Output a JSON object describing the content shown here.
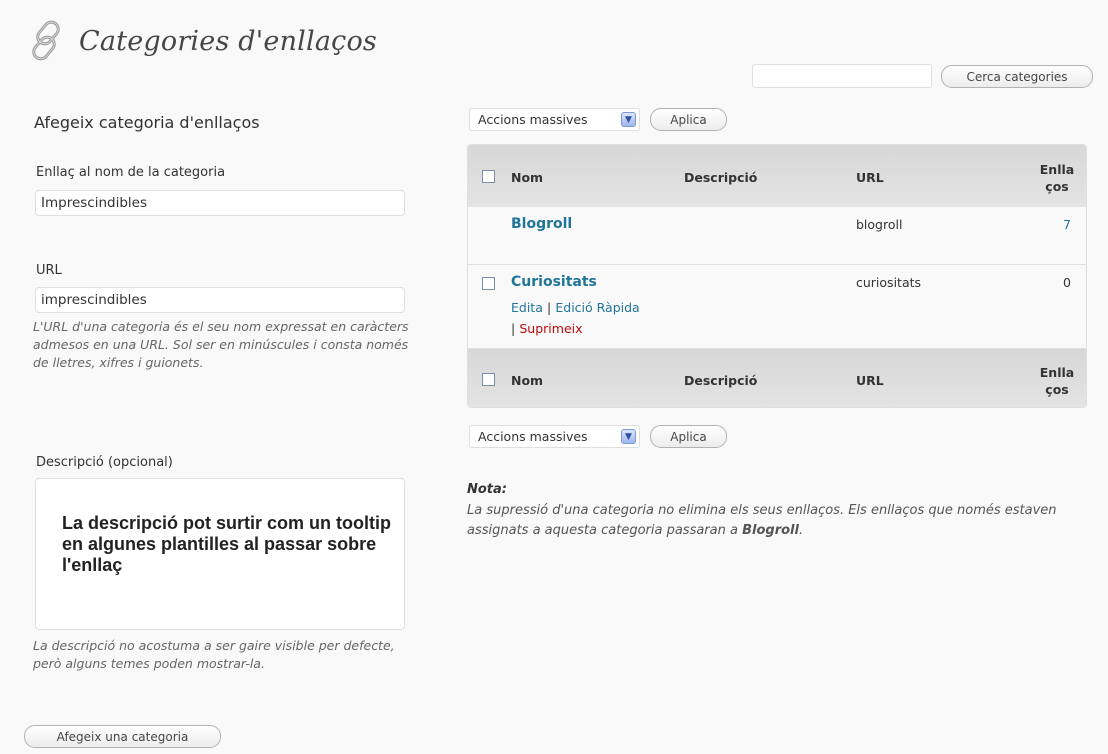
{
  "page": {
    "title": "Categories d'enllaços",
    "icon": "link-icon"
  },
  "search": {
    "button_label": "Cerca categories",
    "placeholder": ""
  },
  "form": {
    "heading": "Afegeix categoria d'enllaços",
    "name_label": "Enllaç al nom de la categoria",
    "name_value": "Imprescindibles",
    "url_label": "URL",
    "url_value": "imprescindibles",
    "url_help": "L'URL d'una categoria és el seu nom expressat en caràcters admesos en una URL. Sol ser en minúscules i consta només de lletres, xifres i guionets.",
    "desc_label": "Descripció (opcional)",
    "desc_annotation": "La descripció pot surtir com un tooltip en algunes plantilles al passar sobre l'enllaç",
    "desc_help": "La descripció no acostuma a ser gaire visible per defecte, però alguns temes poden mostrar-la.",
    "submit_label": "Afegeix una categoria"
  },
  "bulk": {
    "select_label": "Accions massives",
    "apply_label": "Aplica"
  },
  "table": {
    "columns": {
      "name": "Nom",
      "description": "Descripció",
      "url": "URL",
      "links": "Enllaços"
    },
    "rows": [
      {
        "name": "Blogroll",
        "description": "",
        "url": "blogroll",
        "count": "7"
      },
      {
        "name": "Curiositats",
        "description": "",
        "url": "curiositats",
        "count": "0",
        "actions": {
          "edit": "Edita",
          "quick_edit": "Edició Ràpida",
          "delete": "Suprimeix",
          "sep": "|"
        }
      }
    ]
  },
  "note": {
    "title": "Nota:",
    "body_prefix": "La supressió d'una categoria no elimina els seus enllaços. Els enllaços que només estaven assignats a aquesta categoria passaran a ",
    "body_bold": "Blogroll",
    "body_suffix": "."
  },
  "colors": {
    "link": "#21759b",
    "delete": "#bc0b0b",
    "background": "#f9f9f9",
    "table_header": "#dfdfdf"
  }
}
